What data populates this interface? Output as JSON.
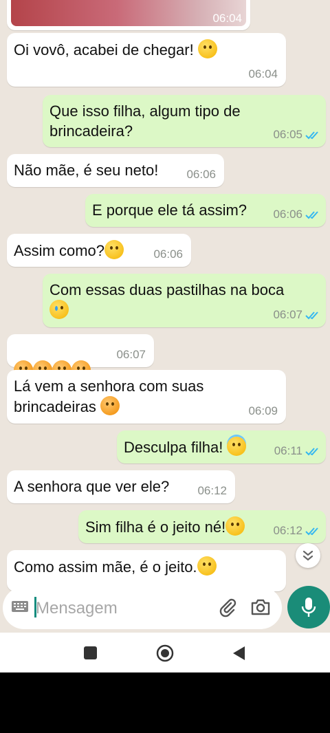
{
  "chat": {
    "first_image_time": "06:04",
    "messages": [
      {
        "dir": "in",
        "text": "Oi vovô, acabei de chegar! ",
        "emoji": [
          "smile"
        ],
        "time": "06:04"
      },
      {
        "dir": "out",
        "text": "Que isso filha, algum tipo de\nbrincadeira?",
        "emoji": [],
        "time": "06:05"
      },
      {
        "dir": "in",
        "text": "Não mãe, é seu neto!",
        "emoji": [],
        "time": "06:06"
      },
      {
        "dir": "out",
        "text": "E porque ele tá assim?",
        "emoji": [],
        "time": "06:06"
      },
      {
        "dir": "in",
        "text": "Assim como?",
        "emoji": [
          "thinking"
        ],
        "time": "06:06"
      },
      {
        "dir": "out",
        "text": "Com essas duas pastilhas na boca\n",
        "emoji": [
          "tears-of-joy"
        ],
        "time": "06:07"
      },
      {
        "dir": "in",
        "text": "",
        "emoji": [
          "angry",
          "angry",
          "angry",
          "angry"
        ],
        "time": "06:07"
      },
      {
        "dir": "in",
        "text": "Lá vem a senhora com suas\nbrincadeiras ",
        "emoji": [
          "angry"
        ],
        "time": "06:09"
      },
      {
        "dir": "out",
        "text": "Desculpa filha! ",
        "emoji": [
          "halo"
        ],
        "time": "06:11"
      },
      {
        "dir": "in",
        "text": "A senhora que ver ele?",
        "emoji": [],
        "time": "06:12"
      },
      {
        "dir": "out",
        "text": "Sim filha é o jeito né!",
        "emoji": [
          "hand-over-mouth"
        ],
        "time": "06:12"
      },
      {
        "dir": "in",
        "text": "Como assim mãe, é o jeito.",
        "emoji": [
          "eye-roll"
        ],
        "time": ""
      }
    ]
  },
  "input": {
    "placeholder": "Mensagem"
  },
  "icons": {
    "keyboard": "keyboard-icon",
    "attach": "paperclip-icon",
    "camera": "camera-icon",
    "mic": "microphone-icon",
    "scroll": "double-chevron-down-icon",
    "nav_recents": "square-icon",
    "nav_home": "circle-icon",
    "nav_back": "triangle-back-icon"
  },
  "colors": {
    "incoming": "#ffffff",
    "outgoing": "#dcf8c6",
    "accent": "#1a8c78",
    "read_ticks": "#34b7f1"
  }
}
